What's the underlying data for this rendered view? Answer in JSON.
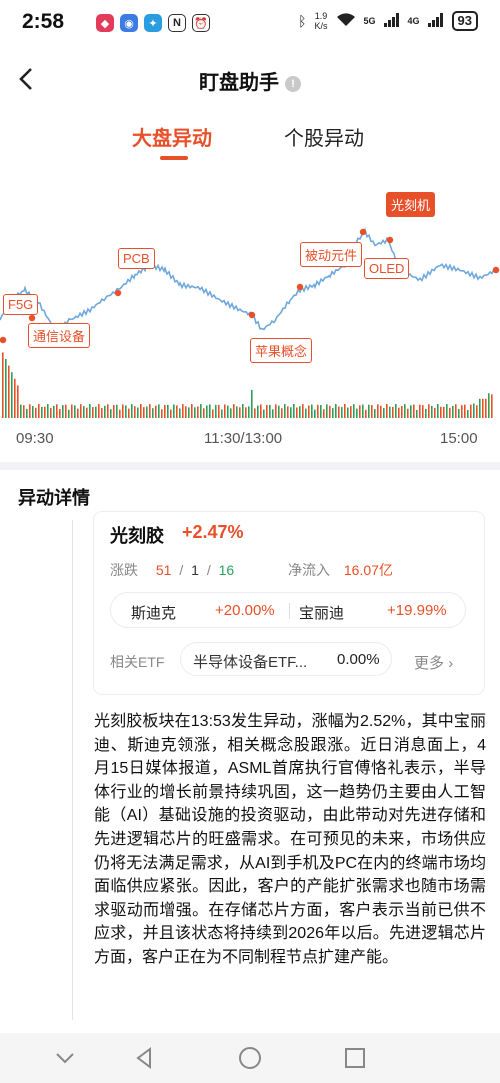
{
  "status": {
    "time": "2:58",
    "speed_value": "1.9",
    "speed_unit": "K/s",
    "net1": "5G",
    "net2": "4G",
    "battery": "93"
  },
  "header": {
    "title": "盯盘助手"
  },
  "tabs": [
    {
      "label": "大盘异动",
      "active": true
    },
    {
      "label": "个股异动",
      "active": false
    }
  ],
  "chart_data": {
    "type": "line",
    "x_ticks": [
      "09:30",
      "11:30/13:00",
      "15:00"
    ],
    "annotations": [
      {
        "label": "F5G",
        "style": "outline"
      },
      {
        "label": "通信设备",
        "style": "outline"
      },
      {
        "label": "PCB",
        "style": "outline"
      },
      {
        "label": "苹果概念",
        "style": "outline"
      },
      {
        "label": "被动元件",
        "style": "outline"
      },
      {
        "label": "光刻机",
        "style": "filled"
      },
      {
        "label": "OLED",
        "style": "outline"
      }
    ],
    "line_color": "#6fa8dc",
    "volume_colors": [
      "#e8502a",
      "#2aa05a"
    ]
  },
  "section": {
    "title": "异动详情"
  },
  "card": {
    "name": "光刻胶",
    "change": "+2.47%",
    "zd_label": "涨跌",
    "zd_up": "51",
    "zd_flat": "1",
    "zd_down": "16",
    "sep": "/",
    "inflow_label": "净流入",
    "inflow_value": "16.07亿",
    "stocks": [
      {
        "name": "斯迪克",
        "change": "+20.00%"
      },
      {
        "name": "宝丽迪",
        "change": "+19.99%"
      }
    ],
    "etf_label": "相关ETF",
    "etf_name": "半导体设备ETF...",
    "etf_value": "0.00%",
    "more": "更多"
  },
  "description": "光刻胶板块在13:53发生异动，涨幅为2.52%，其中宝丽迪、斯迪克领涨，相关概念股跟涨。近日消息面上，4月15日媒体报道，ASML首席执行官傅恪礼表示，半导体行业的增长前景持续巩固，这一趋势仍主要由人工智能（AI）基础设施的投资驱动，由此带动对先进存储和先进逻辑芯片的旺盛需求。在可预见的未来，市场供应仍将无法满足需求，从AI到手机及PC在内的终端市场均面临供应紧张。因此，客户的产能扩张需求也随市场需求驱动而增强。在存储芯片方面，客户表示当前已供不应求，并且该状态将持续到2026年以后。先进逻辑芯片方面，客户正在为不同制程节点扩建产能。",
  "icons": {
    "back": "chevron-left-icon",
    "info": "info-icon",
    "more_chevron": "chevron-right-icon"
  }
}
